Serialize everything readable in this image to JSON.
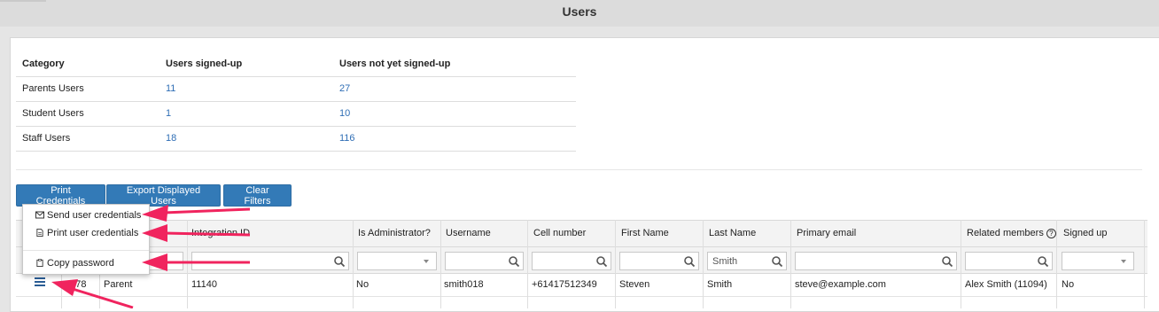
{
  "page": {
    "title": "Users"
  },
  "summary": {
    "headers": [
      "Category",
      "Users signed-up",
      "Users not yet signed-up"
    ],
    "rows": [
      {
        "category": "Parents Users",
        "signed_up": "11",
        "not_signed_up": "27"
      },
      {
        "category": "Student Users",
        "signed_up": "1",
        "not_signed_up": "10"
      },
      {
        "category": "Staff Users",
        "signed_up": "18",
        "not_signed_up": "116"
      }
    ]
  },
  "toolbar": {
    "print_credentials": "Print Credentials",
    "export_users": "Export Displayed Users",
    "clear_filters": "Clear Filters"
  },
  "menu": {
    "send_credentials": "Send user credentials",
    "print_credentials": "Print user credentials",
    "copy_password": "Copy password"
  },
  "grid": {
    "headers": {
      "integration_id": "Integration ID",
      "is_admin": "Is Administrator?",
      "username": "Username",
      "cell_number": "Cell number",
      "first_name": "First Name",
      "last_name": "Last Name",
      "primary_email": "Primary email",
      "related_members": "Related members",
      "signed_up": "Signed up"
    },
    "filters": {
      "last_name": "Smith"
    },
    "row": {
      "id": "9378",
      "type": "Parent",
      "integration_id": "11140",
      "is_admin": "No",
      "username": "smith018",
      "cell_number": "+61417512349",
      "first_name": "Steven",
      "last_name": "Smith",
      "primary_email": "steve@example.com",
      "related_members": "Alex Smith (11094)",
      "signed_up": "No"
    }
  },
  "colors": {
    "primary_button": "#337ab7",
    "link": "#2f6eb5",
    "annotation_arrow": "#f0245e"
  }
}
